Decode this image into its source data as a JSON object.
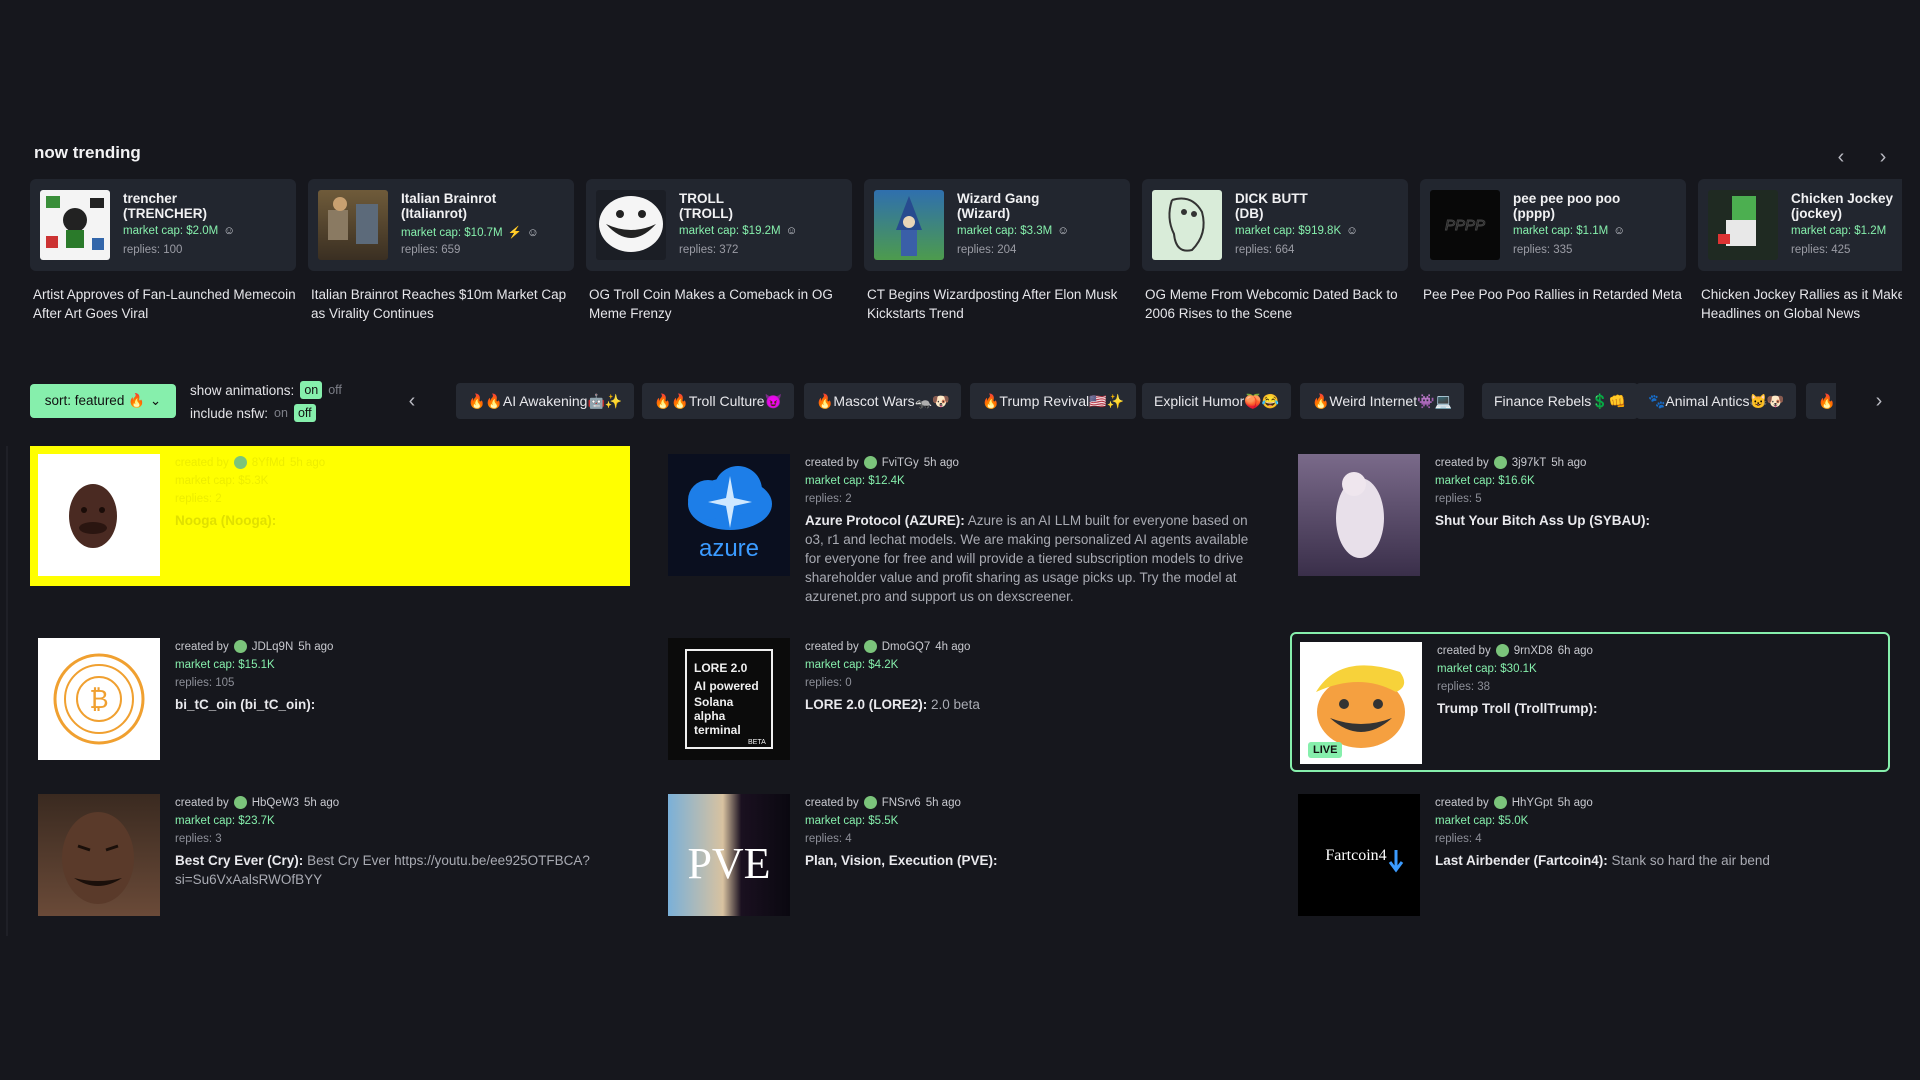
{
  "trending": {
    "title": "now trending",
    "cards": [
      {
        "name": "trencher\n(TRENCHER)",
        "mcap": "market cap: $2.0M",
        "replies": "replies: 100",
        "headline": "Artist Approves of Fan-Launched Memecoin After Art Goes Viral"
      },
      {
        "name": "Italian Brainrot\n(Italianrot)",
        "mcap": "market cap: $10.7M",
        "replies": "replies: 659",
        "headline": "Italian Brainrot Reaches $10m Market Cap as Virality Continues"
      },
      {
        "name": "TROLL\n(TROLL)",
        "mcap": "market cap: $19.2M",
        "replies": "replies: 372",
        "headline": "OG Troll Coin Makes a Comeback in OG Meme Frenzy"
      },
      {
        "name": "Wizard Gang\n(Wizard)",
        "mcap": "market cap: $3.3M",
        "replies": "replies: 204",
        "headline": "CT Begins Wizardposting After Elon Musk Kickstarts Trend"
      },
      {
        "name": "DICK BUTT\n(DB)",
        "mcap": "market cap: $919.8K",
        "replies": "replies: 664",
        "headline": "OG Meme From Webcomic Dated Back to 2006 Rises to the Scene"
      },
      {
        "name": "pee pee poo poo\n(pppp)",
        "mcap": "market cap: $1.1M",
        "replies": "replies: 335",
        "headline": "Pee Pee Poo Poo Rallies in Retarded Meta"
      },
      {
        "name": "Chicken Jockey\n(jockey)",
        "mcap": "market cap: $1.2M",
        "replies": "replies: 425",
        "headline": "Chicken Jockey Rallies as it Makes Headlines on Global News"
      }
    ]
  },
  "controls": {
    "sort_label": "sort: featured 🔥",
    "animations_label": "show animations:",
    "animations_on": "on",
    "animations_off": "off",
    "nsfw_label": "include nsfw:",
    "nsfw_on": "on",
    "nsfw_off": "off"
  },
  "chips": [
    "🔥🔥AI Awakening🤖✨",
    "🔥🔥Troll Culture😈",
    "🔥Mascot Wars🦡🐶",
    "🔥Trump Revival🇺🇸✨",
    "Explicit Humor🍑😂",
    "🔥Weird Internet👾💻",
    "Finance Rebels💲👊",
    "🐾Animal Antics😺🐶",
    "🔥"
  ],
  "coins": [
    {
      "creator": "8YfMd",
      "time": "5h ago",
      "mcap": "market cap: $5.3K",
      "replies": "replies: 2",
      "title": "Nooga (Nooga):",
      "desc": ""
    },
    {
      "creator": "FviTGy",
      "time": "5h ago",
      "mcap": "market cap: $12.4K",
      "replies": "replies: 2",
      "title": "Azure Protocol (AZURE):",
      "desc": "Azure is an AI LLM built for everyone based on o3, r1 and lechat models. We are making personalized AI agents available for everyone for free and will provide a tiered subscription models to drive shareholder value and profit sharing as usage picks up. Try the model at azurenet.pro and support us on dexscreener."
    },
    {
      "creator": "3j97kT",
      "time": "5h ago",
      "mcap": "market cap: $16.6K",
      "replies": "replies: 5",
      "title": "Shut Your Bitch Ass Up (SYBAU):",
      "desc": ""
    },
    {
      "creator": "JDLq9N",
      "time": "5h ago",
      "mcap": "market cap: $15.1K",
      "replies": "replies: 105",
      "title": "bi_tC_oin (bi_tC_oin):",
      "desc": ""
    },
    {
      "creator": "DmoGQ7",
      "time": "4h ago",
      "mcap": "market cap: $4.2K",
      "replies": "replies: 0",
      "title": "LORE 2.0 (LORE2):",
      "desc": "2.0 beta"
    },
    {
      "creator": "9rnXD8",
      "time": "6h ago",
      "mcap": "market cap: $30.1K",
      "replies": "replies: 38",
      "title": "Trump Troll (TrollTrump):",
      "desc": "",
      "live": "LIVE"
    },
    {
      "creator": "HbQeW3",
      "time": "5h ago",
      "mcap": "market cap: $23.7K",
      "replies": "replies: 3",
      "title": "Best Cry Ever (Cry):",
      "desc": "Best Cry Ever https://youtu.be/ee925OTFBCA?si=Su6VxAalsRWOfBYY"
    },
    {
      "creator": "FNSrv6",
      "time": "5h ago",
      "mcap": "market cap: $5.5K",
      "replies": "replies: 4",
      "title": "Plan, Vision, Execution (PVE):",
      "desc": ""
    },
    {
      "creator": "HhYGpt",
      "time": "5h ago",
      "mcap": "market cap: $5.0K",
      "replies": "replies: 4",
      "title": "Last Airbender (Fartcoin4):",
      "desc": "Stank so hard the air bend"
    }
  ],
  "thumbs": {
    "lore_lines": [
      "LORE 2.0",
      "AI powered",
      "Solana",
      "alpha",
      "terminal",
      "BETA"
    ],
    "azure_text": "azure",
    "pve_text": "PVE",
    "fart_text": "Fartcoin4"
  }
}
